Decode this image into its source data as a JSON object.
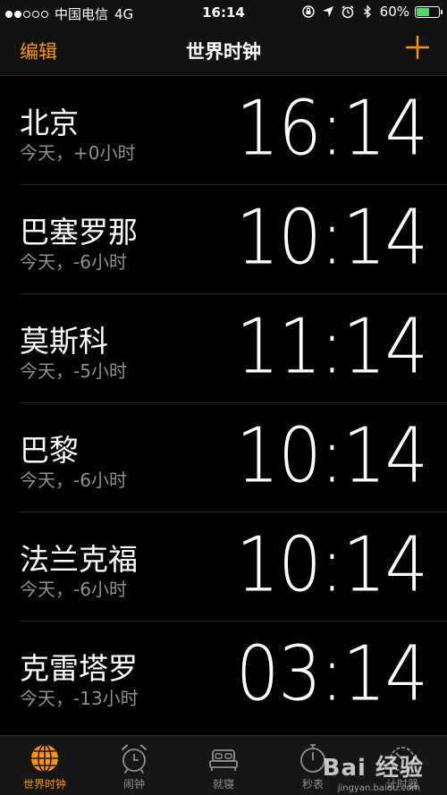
{
  "status_bar": {
    "carrier": "中国电信",
    "network": "4G",
    "time": "16:14",
    "battery_percent": "60%",
    "battery_level": 0.6,
    "battery_color": "#4cd964"
  },
  "nav": {
    "edit_label": "编辑",
    "title": "世界时钟",
    "add_icon": "plus-icon",
    "accent_color": "#ff9500"
  },
  "clocks": [
    {
      "city": "北京",
      "offset": "今天，+0小时",
      "time": "16:14"
    },
    {
      "city": "巴塞罗那",
      "offset": "今天，-6小时",
      "time": "10:14"
    },
    {
      "city": "莫斯科",
      "offset": "今天，-5小时",
      "time": "11:14"
    },
    {
      "city": "巴黎",
      "offset": "今天，-6小时",
      "time": "10:14"
    },
    {
      "city": "法兰克福",
      "offset": "今天，-6小时",
      "time": "10:14"
    },
    {
      "city": "克雷塔罗",
      "offset": "今天，-13小时",
      "time": "03:14"
    }
  ],
  "tabs": [
    {
      "label": "世界时钟",
      "icon": "globe-icon",
      "active": true
    },
    {
      "label": "闹钟",
      "icon": "alarm-clock-icon",
      "active": false
    },
    {
      "label": "就寝",
      "icon": "bed-icon",
      "active": false
    },
    {
      "label": "秒表",
      "icon": "stopwatch-icon",
      "active": false
    },
    {
      "label": "计时器",
      "icon": "timer-icon",
      "active": false
    }
  ],
  "watermark": {
    "text": "Bai 经验",
    "sub": "jingyan.baidu.com"
  }
}
